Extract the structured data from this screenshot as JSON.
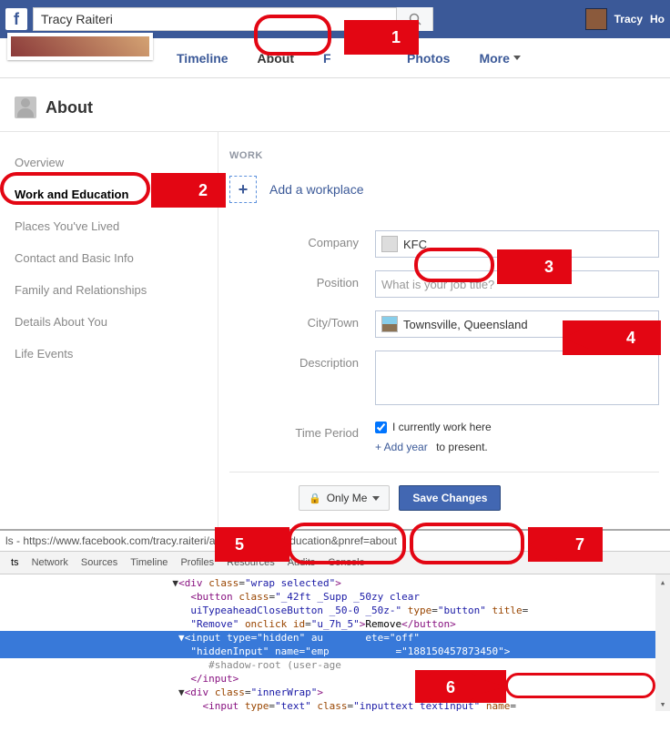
{
  "topbar": {
    "search_value": "Tracy Raiteri",
    "user_name": "Tracy",
    "nav_right": "Ho"
  },
  "tabs": {
    "timeline": "Timeline",
    "about": "About",
    "friends_partial": "F",
    "photos": "Photos",
    "more": "More"
  },
  "about": {
    "title": "About"
  },
  "sidebar": {
    "items": [
      "Overview",
      "Work and Education",
      "Places You've Lived",
      "Contact and Basic Info",
      "Family and Relationships",
      "Details About You",
      "Life Events"
    ]
  },
  "work": {
    "section_label": "WORK",
    "add_label": "Add a workplace",
    "company_label": "Company",
    "company_value": "KFC",
    "position_label": "Position",
    "position_placeholder": "What is your job title?",
    "city_label": "City/Town",
    "city_value": "Townsville, Queensland",
    "description_label": "Description",
    "timeperiod_label": "Time Period",
    "currently_work": "I currently work here",
    "add_year": "+ Add year",
    "to_present": "to present."
  },
  "buttons": {
    "privacy": "Only Me",
    "save": "Save Changes"
  },
  "devtools": {
    "url": "ls - https://www.facebook.com/tracy.raiteri/about?section=education&pnref=about",
    "tabs": [
      "ts",
      "Network",
      "Sources",
      "Timeline",
      "Profiles",
      "Resources",
      "Audits",
      "Console"
    ],
    "code": {
      "l1_pre": "                            ▼",
      "l1_div": "div",
      "l1_cls": "wrap selected",
      "l2_pre": "                               ",
      "l2_btn": "button",
      "l2_cls": "_42ft _Supp _50zy clear",
      "l3_pre": "                               ",
      "l3_cls": "uiTypeaheadCloseButton _50-0 _50z-",
      "l3_type": "button",
      "l3_title": "",
      "l4_pre": "                               ",
      "l4_a1": "Remove",
      "l4_a2": "u_7h_5",
      "l4_txt": "Remove",
      "l5_pre": "                             ▼",
      "l5_tag": "input",
      "l5_a1": "hidden",
      "l5_a2": "off",
      "l6_pre": "                               ",
      "l6_cls": "hiddenInput",
      "l6_name": "emp",
      "l6_val": "188150457873450",
      "l7_pre": "                                  ",
      "l7_txt": "#shadow-root (user-age",
      "l8_pre": "                               ",
      "l9_pre": "                             ▼",
      "l9_cls": "innerWrap",
      "l10_pre": "                                 ",
      "l10_cls": "inputtext textInput"
    }
  },
  "annotations": {
    "n1": "1",
    "n2": "2",
    "n3": "3",
    "n4": "4",
    "n5": "5",
    "n6": "6",
    "n7": "7"
  }
}
